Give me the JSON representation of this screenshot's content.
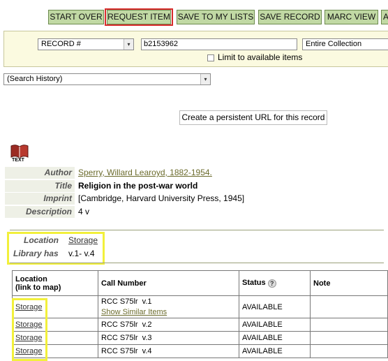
{
  "toolbar": {
    "start_over": "START OVER",
    "request_item": "REQUEST ITEM",
    "save_to_lists": "SAVE TO MY LISTS",
    "save_record": "SAVE RECORD",
    "marc_view": "MARC VIEW",
    "next_partial": "A"
  },
  "search": {
    "index_select": "RECORD #",
    "query_value": "b2153962",
    "scope_select": "Entire Collection",
    "limit_label": "Limit to available items",
    "limit_checked": false,
    "history_select": "(Search History)"
  },
  "persistent_url_label": "Create a persistent URL for this record",
  "format_icon_label": "TEXT",
  "bib": {
    "author_label": "Author",
    "author_value": "Sperry, Willard Learoyd, 1882-1954.",
    "title_label": "Title",
    "title_value": "Religion in the post-war world",
    "imprint_label": "Imprint",
    "imprint_value": "[Cambridge, Harvard University Press, 1945]",
    "description_label": "Description",
    "description_value": "4 v"
  },
  "holdings": {
    "location_label": "Location",
    "location_value": "Storage",
    "library_has_label": "Library has",
    "library_has_value": "v.1- v.4"
  },
  "items_table": {
    "col_location_line1": "Location",
    "col_location_line2": "(link to map)",
    "col_call_number": "Call Number",
    "col_status": "Status",
    "col_status_icon": "?",
    "col_note": "Note",
    "rows": [
      {
        "location": "Storage",
        "call_number": "RCC S75lr  v.1",
        "extra_link": "Show Similar Items",
        "status": "AVAILABLE",
        "note": ""
      },
      {
        "location": "Storage",
        "call_number": "RCC S75lr  v.2",
        "status": "AVAILABLE",
        "note": ""
      },
      {
        "location": "Storage",
        "call_number": "RCC S75lr  v.3",
        "status": "AVAILABLE",
        "note": ""
      },
      {
        "location": "Storage",
        "call_number": "RCC S75lr  v.4",
        "status": "AVAILABLE",
        "note": ""
      }
    ]
  },
  "colors": {
    "button_bg": "#c1d9a4",
    "highlight_red": "#d82b2b",
    "highlight_yellow": "#f2f03b",
    "search_panel_bg": "#fbfae0"
  }
}
